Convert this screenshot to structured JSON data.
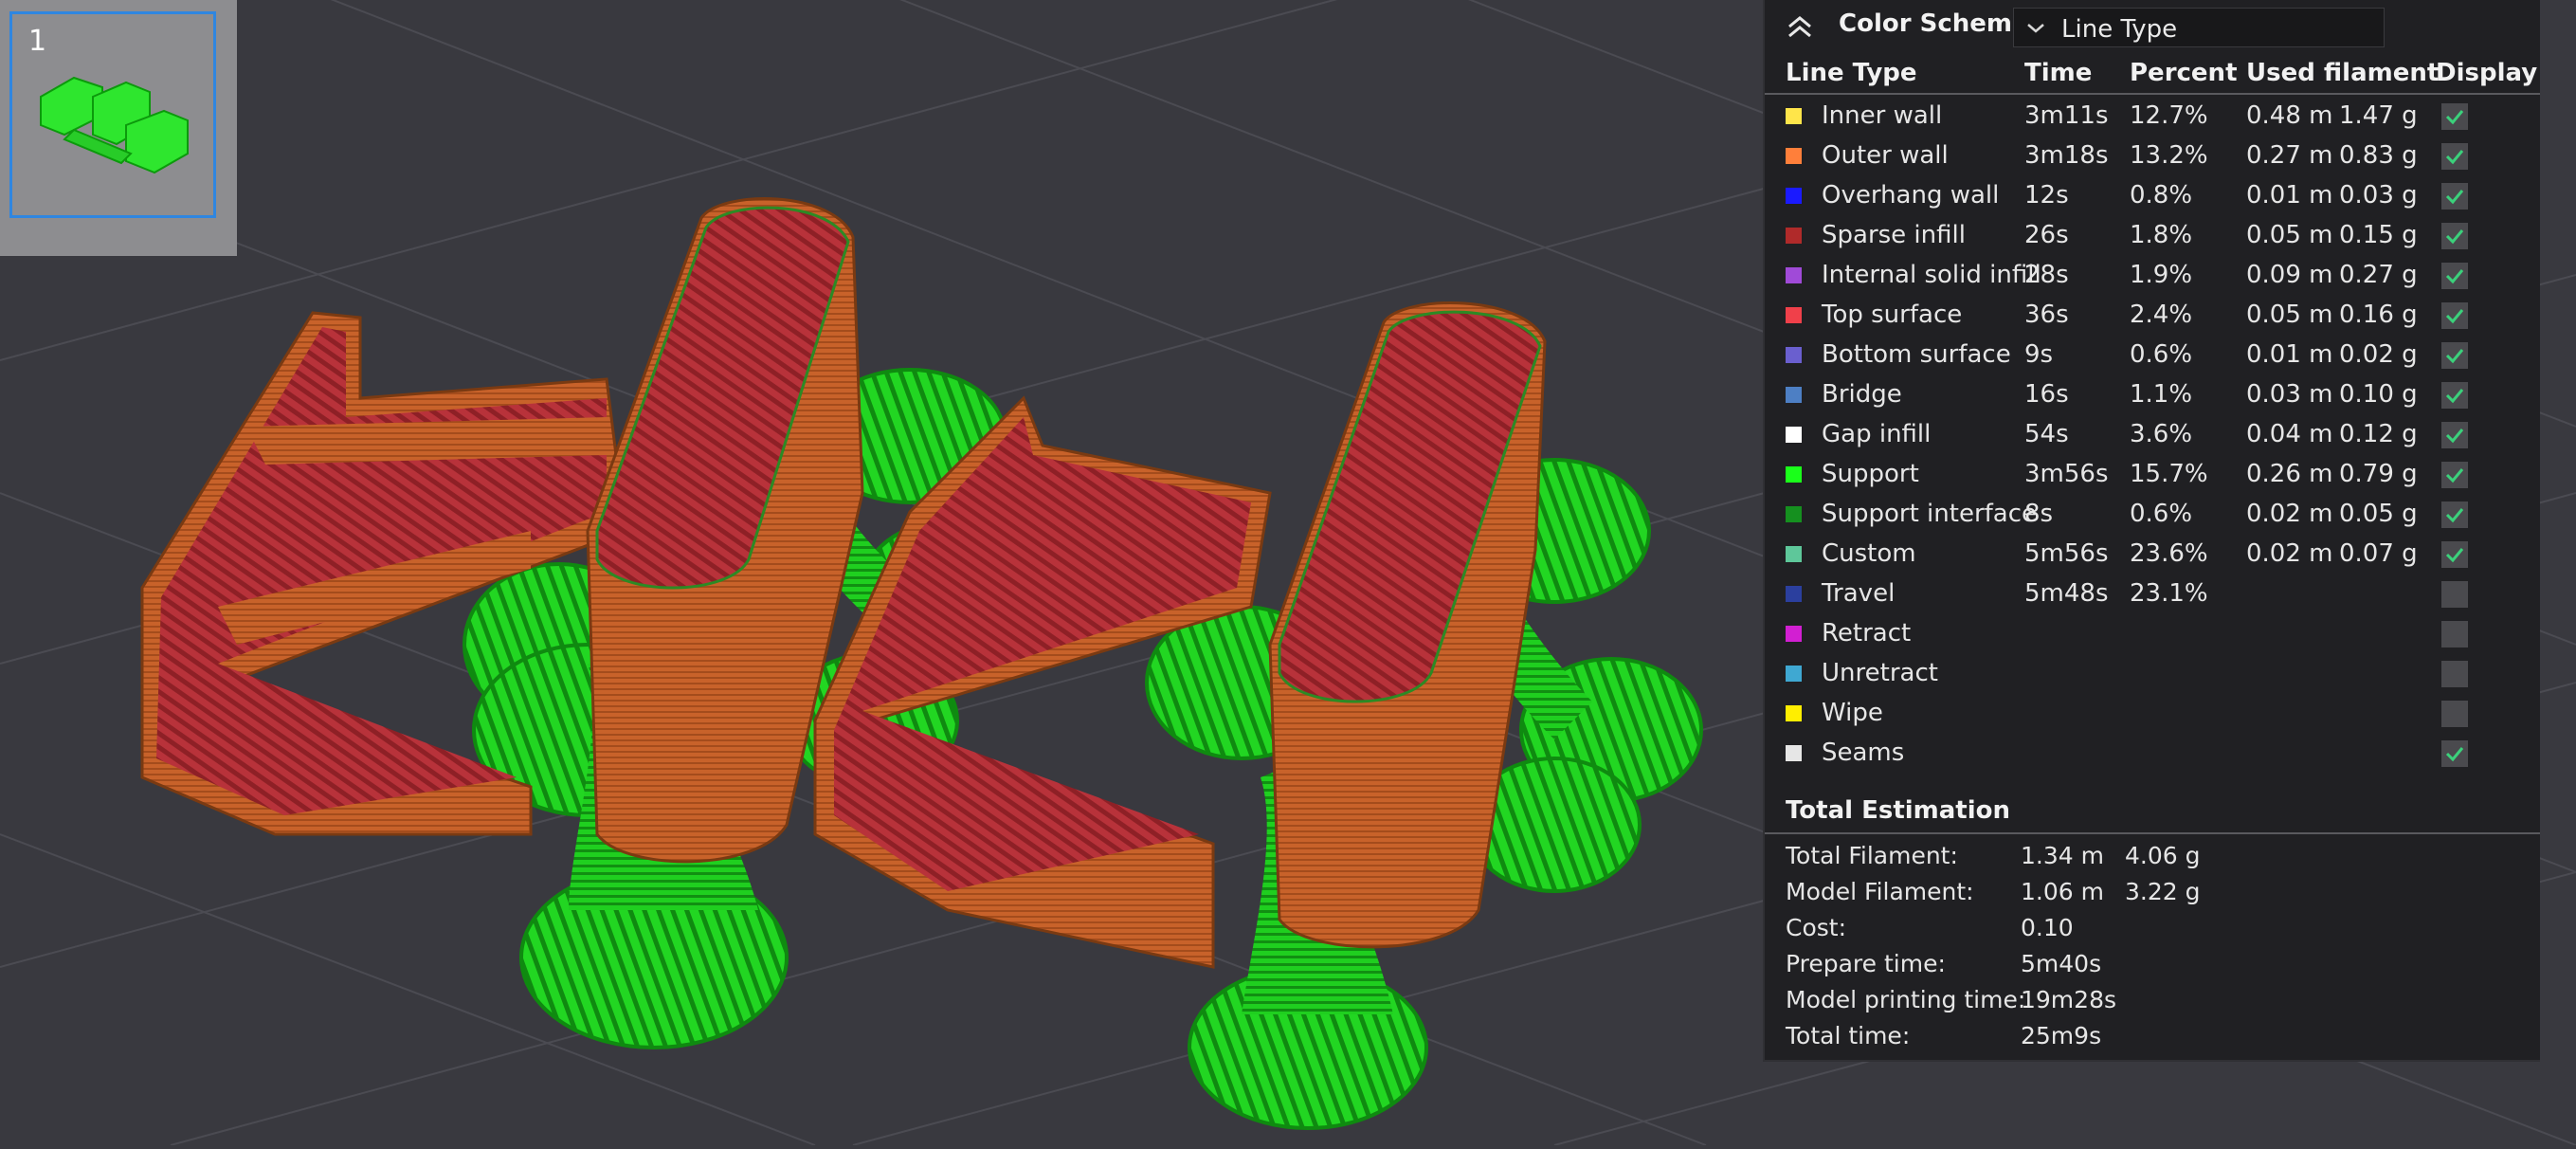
{
  "plate": {
    "number": "1"
  },
  "panel": {
    "title": "Color Scheme",
    "scheme_value": "Line Type",
    "columns": {
      "line_type": "Line Type",
      "time": "Time",
      "percent": "Percent",
      "used_filament": "Used filament",
      "display": "Display"
    },
    "rows": [
      {
        "name": "Inner wall",
        "color": "#ffe54a",
        "time": "3m11s",
        "percent": "12.7%",
        "meters": "0.48 m",
        "grams": "1.47 g",
        "display": true
      },
      {
        "name": "Outer wall",
        "color": "#ff7f3a",
        "time": "3m18s",
        "percent": "13.2%",
        "meters": "0.27 m",
        "grams": "0.83 g",
        "display": true
      },
      {
        "name": "Overhang wall",
        "color": "#1a1aff",
        "time": "12s",
        "percent": "0.8%",
        "meters": "0.01 m",
        "grams": "0.03 g",
        "display": true
      },
      {
        "name": "Sparse infill",
        "color": "#b02a2a",
        "time": "26s",
        "percent": "1.8%",
        "meters": "0.05 m",
        "grams": "0.15 g",
        "display": true
      },
      {
        "name": "Internal solid infill",
        "color": "#a04ad8",
        "time": "28s",
        "percent": "1.9%",
        "meters": "0.09 m",
        "grams": "0.27 g",
        "display": true
      },
      {
        "name": "Top surface",
        "color": "#f0404a",
        "time": "36s",
        "percent": "2.4%",
        "meters": "0.05 m",
        "grams": "0.16 g",
        "display": true
      },
      {
        "name": "Bottom surface",
        "color": "#6a5fcf",
        "time": "9s",
        "percent": "0.6%",
        "meters": "0.01 m",
        "grams": "0.02 g",
        "display": true
      },
      {
        "name": "Bridge",
        "color": "#4d7fc4",
        "time": "16s",
        "percent": "1.1%",
        "meters": "0.03 m",
        "grams": "0.10 g",
        "display": true
      },
      {
        "name": "Gap infill",
        "color": "#ffffff",
        "time": "54s",
        "percent": "3.6%",
        "meters": "0.04 m",
        "grams": "0.12 g",
        "display": true
      },
      {
        "name": "Support",
        "color": "#1aff1a",
        "time": "3m56s",
        "percent": "15.7%",
        "meters": "0.26 m",
        "grams": "0.79 g",
        "display": true
      },
      {
        "name": "Support interface",
        "color": "#15901f",
        "time": "8s",
        "percent": "0.6%",
        "meters": "0.02 m",
        "grams": "0.05 g",
        "display": true
      },
      {
        "name": "Custom",
        "color": "#5ec79a",
        "time": "5m56s",
        "percent": "23.6%",
        "meters": "0.02 m",
        "grams": "0.07 g",
        "display": true
      },
      {
        "name": "Travel",
        "color": "#2b3f9e",
        "time": "5m48s",
        "percent": "23.1%",
        "meters": "",
        "grams": "",
        "display": false
      },
      {
        "name": "Retract",
        "color": "#d21fd2",
        "time": "",
        "percent": "",
        "meters": "",
        "grams": "",
        "display": false
      },
      {
        "name": "Unretract",
        "color": "#3fa8d2",
        "time": "",
        "percent": "",
        "meters": "",
        "grams": "",
        "display": false
      },
      {
        "name": "Wipe",
        "color": "#ffee00",
        "time": "",
        "percent": "",
        "meters": "",
        "grams": "",
        "display": false
      },
      {
        "name": "Seams",
        "color": "#e6e6e6",
        "time": "",
        "percent": "",
        "meters": "",
        "grams": "",
        "display": true
      }
    ],
    "total_estimation": {
      "title": "Total Estimation",
      "items": [
        {
          "label": "Total Filament:",
          "value": "1.34 m",
          "value2": "4.06 g"
        },
        {
          "label": "Model Filament:",
          "value": "1.06 m",
          "value2": "3.22 g"
        },
        {
          "label": "Cost:",
          "value": "0.10",
          "value2": ""
        },
        {
          "label": "Prepare time:",
          "value": "5m40s",
          "value2": ""
        },
        {
          "label": "Model printing time:",
          "value": "19m28s",
          "value2": ""
        },
        {
          "label": "Total time:",
          "value": "25m9s",
          "value2": ""
        }
      ]
    }
  },
  "colors": {
    "background": "#39393f",
    "model_wall": "#c8622a",
    "top_surface": "#b8323a",
    "support": "#1fcf1f",
    "accent": "#2f86e0",
    "check": "#3bd17b"
  }
}
